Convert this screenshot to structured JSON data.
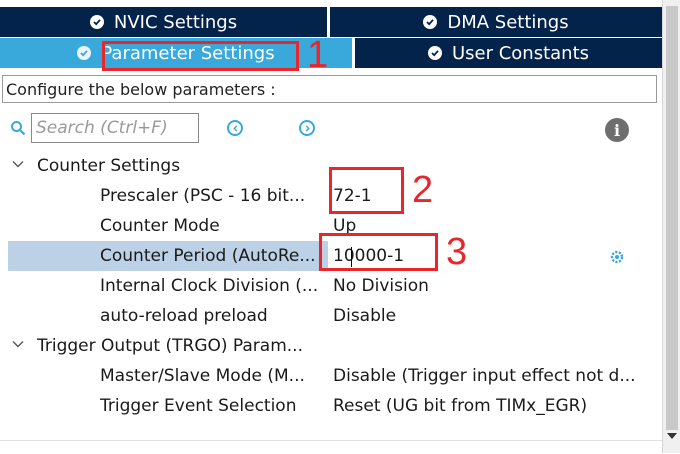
{
  "tabs": {
    "nvic": "NVIC Settings",
    "dma": "DMA Settings",
    "parameter": "Parameter Settings",
    "user_constants": "User Constants"
  },
  "hint": "Configure the below parameters :",
  "search": {
    "placeholder": "Search (Ctrl+F)"
  },
  "groups": [
    {
      "label": "Counter Settings",
      "items": [
        {
          "label": "Prescaler (PSC - 16 bit...",
          "value": "72-1"
        },
        {
          "label": "Counter Mode",
          "value": "Up"
        },
        {
          "label": "Counter Period (AutoRe...",
          "value": "10000-1"
        },
        {
          "label": "Internal Clock Division (...",
          "value": "No Division"
        },
        {
          "label": "auto-reload preload",
          "value": "Disable"
        }
      ]
    },
    {
      "label": "Trigger Output (TRGO) Param...",
      "items": [
        {
          "label": "Master/Slave Mode (M...",
          "value": "Disable (Trigger input effect not d..."
        },
        {
          "label": "Trigger Event Selection",
          "value": "Reset (UG bit from TIMx_EGR)"
        }
      ]
    }
  ],
  "annotations": {
    "one": "1",
    "two": "2",
    "three": "3"
  },
  "colors": {
    "tab_dark": "#03234b",
    "tab_active": "#39a9dc",
    "selection": "#bcd0e6",
    "annotation_red": "#e8262c"
  },
  "icons": {
    "tab_status": "check-circle-icon",
    "info": "info-icon",
    "gear": "gear-icon",
    "search": "search-icon"
  }
}
